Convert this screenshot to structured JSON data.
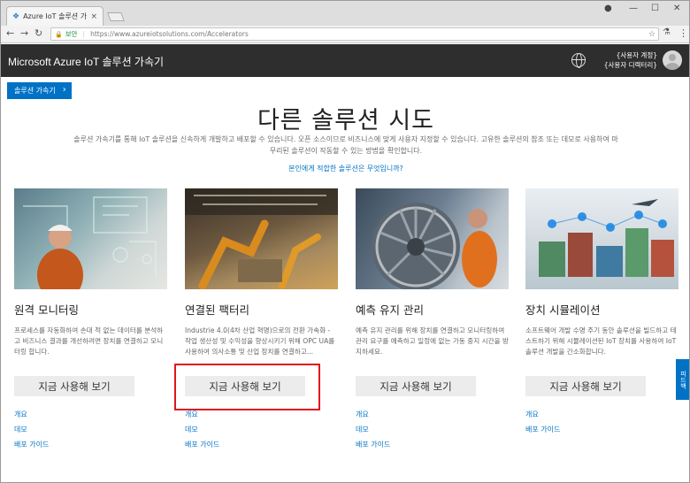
{
  "browser": {
    "tab_title": "Azure IoT 솔루션 가속화",
    "security_label": "보안",
    "url": "https://www.azureiotsolutions.com/Accelerators"
  },
  "header": {
    "brand": "Microsoft Azure IoT 솔루션 가속기",
    "account_line1": "{사용자 계정}",
    "account_line2": "{사용자 디렉터리}"
  },
  "breadcrumb": {
    "label": "솔루션 가속기"
  },
  "hero": {
    "title": "다른 솔루션 시도",
    "subtitle": "솔루션 가속기를 통해 IoT 솔루션을 신속하게 개발하고 배포할 수 있습니다. 오픈 소스이므로 비즈니스에 맞게 사용자 지정할 수 있습니다. 고유한 솔루션의 참조 또는 데모로 사용하여 마무리된 솔루션이 작동할 수 있는 방법을 확인합니다.",
    "link": "본인에게 적합한 솔루션은 무엇입니까?"
  },
  "cards": [
    {
      "title": "원격 모니터링",
      "description": "프로세스를 자동화하여 손대 적 없는 데이터를 분석하고 비즈니스 결과를 개선하려면 장치를 연결하고 모니터링 합니다.",
      "cta": "지금 사용해 보기",
      "links": [
        "개요",
        "데모",
        "배포 가이드"
      ]
    },
    {
      "title": "연결된 팩터리",
      "description": "Industrie 4.0(4차 산업 혁명)으로의 전환 가속화 - 작업 생산성 및 수익성을 향상시키기 위해 OPC UA를 사용하여 의사소통 및 산업 장치를 연결하고...",
      "cta": "지금 사용해 보기",
      "links": [
        "개요",
        "데모",
        "배포 가이드"
      ]
    },
    {
      "title": "예측 유지 관리",
      "description": "예측 유지 관리를 위해 장치를 연결하고 모니터링하여 관리 요구를 예측하고 일정에 없는 가동 중지 시간을 방지하세요.",
      "cta": "지금 사용해 보기",
      "links": [
        "개요",
        "데모",
        "배포 가이드"
      ]
    },
    {
      "title": "장치 시뮬레이션",
      "description": "소프트웨어 개발 수명 주기 동안 솔루션을 빌드하고 테스트하기 위해 시뮬레이션된 IoT 장치를 사용하여 IoT 솔루션 개발을 간소화합니다.",
      "cta": "지금 사용해 보기",
      "links": [
        "개요",
        "배포 가이드"
      ]
    }
  ],
  "feedback": {
    "label": "피드백"
  },
  "colors": {
    "accent": "#0072c6",
    "header_bg": "#2e2e2e",
    "highlight": "#e0161e"
  }
}
